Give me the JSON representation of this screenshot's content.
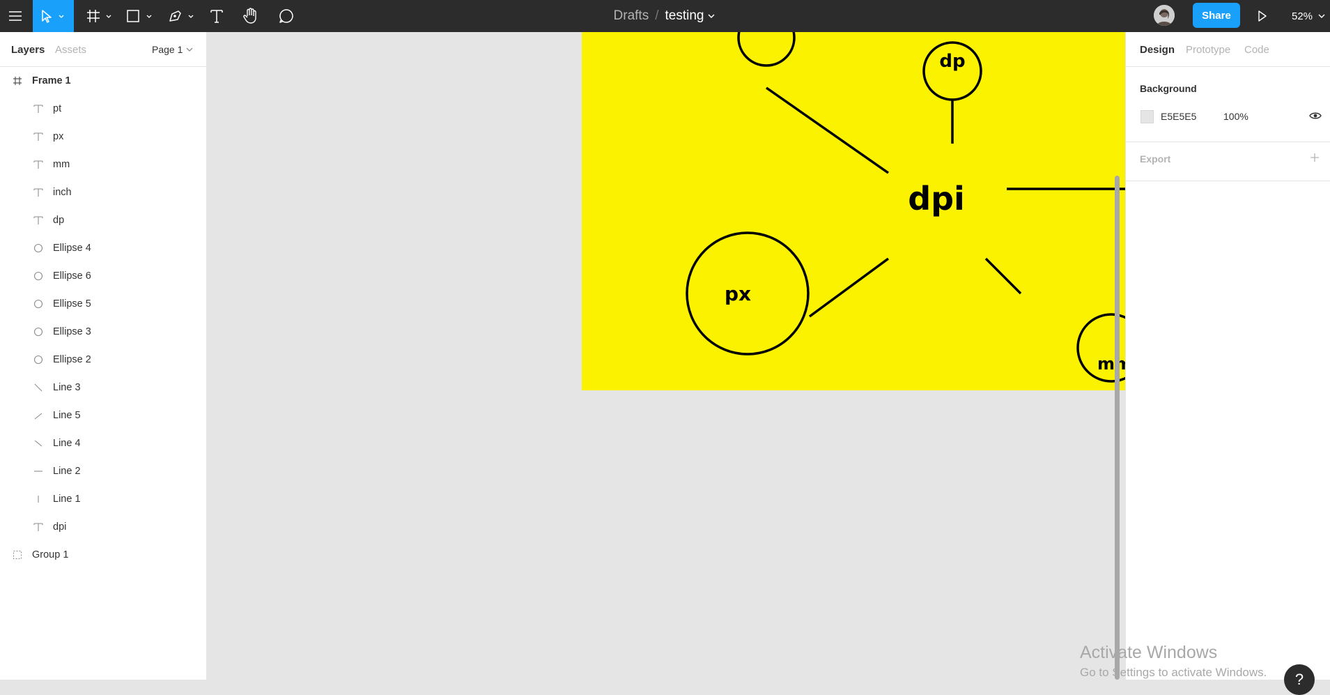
{
  "toolbar": {
    "breadcrumb_folder": "Drafts",
    "breadcrumb_separator": "/",
    "file_name": "testing",
    "share_label": "Share",
    "zoom_label": "52%",
    "icons": [
      "menu-icon",
      "move-tool-icon",
      "frame-tool-icon",
      "shape-tool-icon",
      "pen-tool-icon",
      "text-tool-icon",
      "hand-tool-icon",
      "comment-tool-icon",
      "present-icon"
    ]
  },
  "left_panel": {
    "tabs": [
      "Layers",
      "Assets"
    ],
    "page_selector": "Page 1",
    "layers": [
      {
        "label": "Frame 1",
        "icon": "frame-icon"
      },
      {
        "label": "pt",
        "icon": "text-icon"
      },
      {
        "label": "px",
        "icon": "text-icon"
      },
      {
        "label": "mm",
        "icon": "text-icon"
      },
      {
        "label": "inch",
        "icon": "text-icon"
      },
      {
        "label": "dp",
        "icon": "text-icon"
      },
      {
        "label": "Ellipse 4",
        "icon": "ellipse-icon"
      },
      {
        "label": "Ellipse 6",
        "icon": "ellipse-icon"
      },
      {
        "label": "Ellipse 5",
        "icon": "ellipse-icon"
      },
      {
        "label": "Ellipse 3",
        "icon": "ellipse-icon"
      },
      {
        "label": "Ellipse 2",
        "icon": "ellipse-icon"
      },
      {
        "label": "Line 3",
        "icon": "line-icon"
      },
      {
        "label": "Line 5",
        "icon": "line-icon"
      },
      {
        "label": "Line 4",
        "icon": "line-icon"
      },
      {
        "label": "Line 2",
        "icon": "line-icon"
      },
      {
        "label": "Line 1",
        "icon": "line-icon"
      },
      {
        "label": "dpi",
        "icon": "text-icon"
      },
      {
        "label": "Group 1",
        "icon": "group-icon"
      }
    ]
  },
  "canvas": {
    "frame_color": "#FBF200",
    "texts": {
      "top": "dp",
      "center": "dpi",
      "left": "px",
      "right": "mm"
    }
  },
  "right_panel": {
    "tabs": [
      "Design",
      "Prototype",
      "Code"
    ],
    "background_title": "Background",
    "background_hex": "E5E5E5",
    "background_opacity": "100%",
    "export_title": "Export"
  },
  "overlay": {
    "watermark_title": "Activate Windows",
    "watermark_sub": "Go to Settings to activate Windows.",
    "help_label": "?"
  },
  "colors": {
    "toolbar_bg": "#2C2C2C",
    "accent": "#18A0FB",
    "canvas_bg": "#E5E5E5"
  }
}
